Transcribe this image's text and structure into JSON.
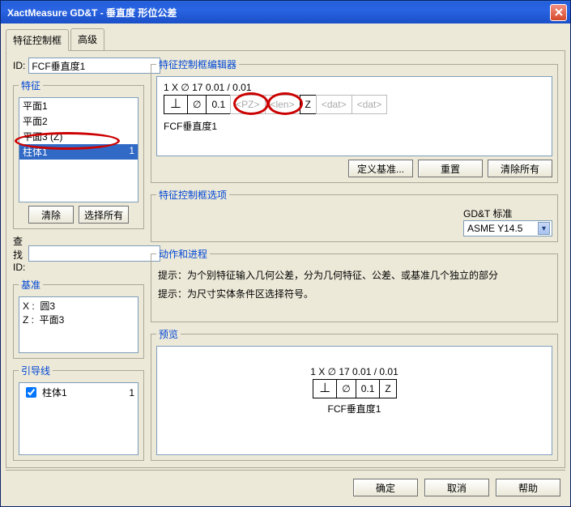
{
  "window": {
    "title": "XactMeasure GD&T - 垂直度 形位公差"
  },
  "tabs": {
    "t1": "特征控制框",
    "t2": "高级"
  },
  "id": {
    "label": "ID:",
    "value": "FCF垂直度1"
  },
  "features": {
    "legend": "特征",
    "items": [
      {
        "label": "平面1",
        "val": ""
      },
      {
        "label": "平面2",
        "val": ""
      },
      {
        "label": "平面3 (Z)",
        "val": ""
      },
      {
        "label": "柱体1",
        "val": "1",
        "selected": true
      }
    ],
    "clear": "清除",
    "selectAll": "选择所有"
  },
  "find": {
    "label": "查找 ID:",
    "value": ""
  },
  "datums": {
    "legend": "基准",
    "text": "X :  圆3\nZ :  平面3"
  },
  "leaders": {
    "legend": "引导线",
    "items": [
      {
        "label": "柱体1",
        "val": "1",
        "checked": true
      }
    ]
  },
  "editor": {
    "legend": "特征控制框编辑器",
    "line1": "1  X  ∅  17  0.01  /  0.01",
    "cells": {
      "sym": "⊥",
      "dia": "∅",
      "tol": "0.1",
      "pz": "<PZ>",
      "len": "<len>",
      "z": "Z",
      "dat1": "<dat>",
      "dat2": "<dat>"
    },
    "below": "FCF垂直度1",
    "defineDatum": "定义基准...",
    "reset": "重置",
    "clearAll": "清除所有"
  },
  "options": {
    "legend": "特征控制框选项",
    "stdLabel": "GD&T 标准",
    "stdValue": "ASME Y14.5"
  },
  "actions": {
    "legend": "动作和进程",
    "hint1": "提示：为个别特征输入几何公差，分为几何特征、公差、或基准几个独立的部分",
    "hint2": "提示：为尺寸实体条件区选择符号。"
  },
  "preview": {
    "legend": "预览",
    "line1": "1  X  ∅  17  0.01  /  0.01",
    "cells": {
      "sym": "⊥",
      "dia": "∅",
      "tol": "0.1",
      "z": "Z"
    },
    "below": "FCF垂直度1"
  },
  "footer": {
    "ok": "确定",
    "cancel": "取消",
    "help": "帮助"
  }
}
